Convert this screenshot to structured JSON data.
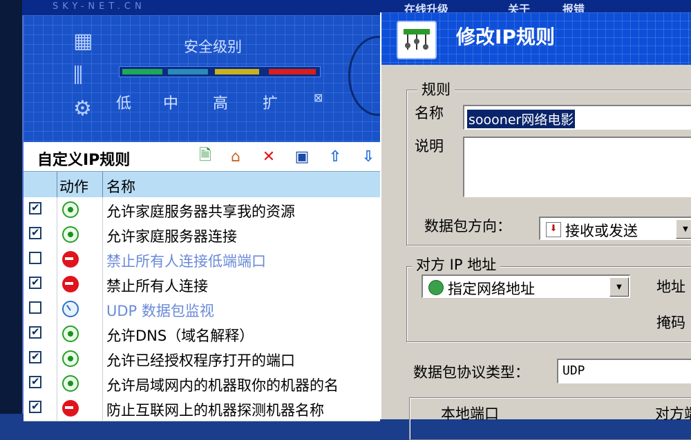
{
  "app": {
    "brand": "SKY-NET.CN",
    "topnav": [
      "在线升级",
      "关于",
      "报错"
    ]
  },
  "security": {
    "title": "安全级别",
    "levels": [
      "低",
      "中",
      "高",
      "扩"
    ]
  },
  "rules_panel": {
    "title": "自定义IP规则",
    "toolbar": [
      {
        "name": "add-rule-icon",
        "glyph": "📄"
      },
      {
        "name": "edit-rule-icon",
        "glyph": "🏠"
      },
      {
        "name": "delete-rule-icon",
        "glyph": "✕"
      },
      {
        "name": "save-icon",
        "glyph": "💾"
      },
      {
        "name": "move-up-icon",
        "glyph": "⇧"
      },
      {
        "name": "move-down-icon",
        "glyph": "⇩"
      }
    ],
    "columns": {
      "action": "动作",
      "name": "名称"
    },
    "rows": [
      {
        "checked": true,
        "action": "allow",
        "name": "允许家庭服务器共享我的资源",
        "disabled": false
      },
      {
        "checked": true,
        "action": "allow",
        "name": "允许家庭服务器连接",
        "disabled": false
      },
      {
        "checked": false,
        "action": "deny",
        "name": "禁止所有人连接低端端口",
        "disabled": true
      },
      {
        "checked": true,
        "action": "deny",
        "name": "禁止所有人连接",
        "disabled": false
      },
      {
        "checked": false,
        "action": "monitor",
        "name": "UDP 数据包监视",
        "disabled": true
      },
      {
        "checked": true,
        "action": "allow",
        "name": "允许DNS（域名解释）",
        "disabled": false
      },
      {
        "checked": true,
        "action": "allow",
        "name": "允许已经授权程序打开的端口",
        "disabled": false
      },
      {
        "checked": true,
        "action": "allow",
        "name": "允许局域网内的机器取你的机器的名",
        "disabled": false
      },
      {
        "checked": true,
        "action": "deny",
        "name": "防止互联网上的机器探测机器名称",
        "disabled": false
      }
    ]
  },
  "dialog": {
    "title": "修改IP规则",
    "rule_group": "规则",
    "name_label": "名称",
    "name_value": "soooner网络电影",
    "desc_label": "说明",
    "desc_value": "",
    "direction_label": "数据包方向：",
    "direction_value": "接收或发送",
    "remote_group": "对方 IP 地址",
    "remote_value": "指定网络地址",
    "address_label": "地址",
    "mask_label": "掩码",
    "protocol_label": "数据包协议类型：",
    "protocol_value": "UDP",
    "local_port_label": "本地端口",
    "remote_port_label": "对方端"
  }
}
